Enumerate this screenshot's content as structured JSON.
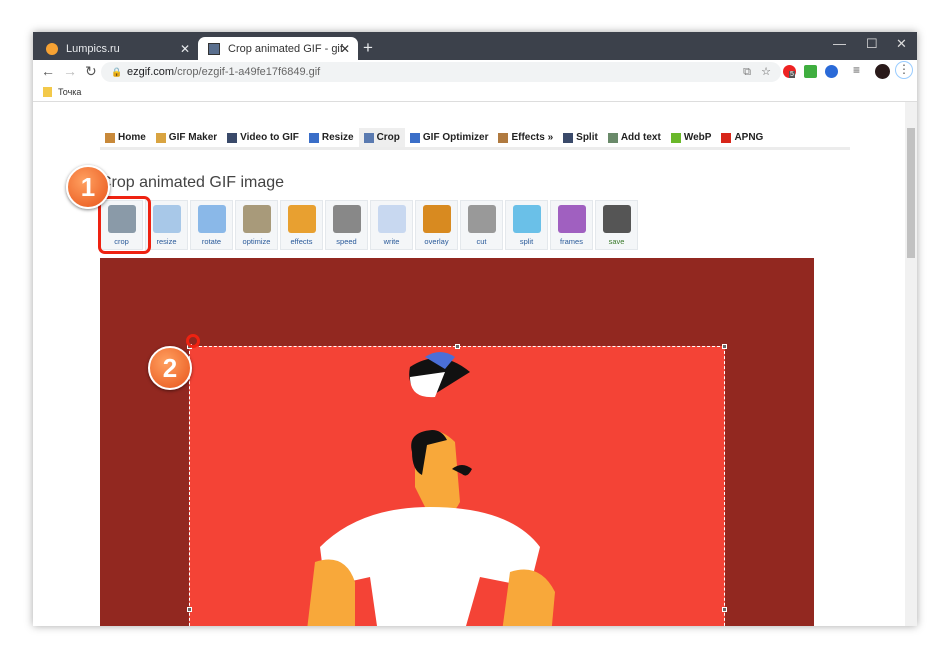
{
  "browser": {
    "tabs": [
      {
        "label": "Lumpics.ru"
      },
      {
        "label": "Crop animated GIF - gif-man-me"
      }
    ],
    "url_host": "ezgif.com",
    "url_path": "/crop/ezgif-1-a49fe17f6849.gif",
    "bookmarks": [
      {
        "label": "Точка"
      }
    ],
    "extension_badge": "5"
  },
  "site": {
    "menu": [
      {
        "label": "Home",
        "color": "#c8893a"
      },
      {
        "label": "GIF Maker",
        "color": "#d9a441"
      },
      {
        "label": "Video to GIF",
        "color": "#3a4a6a"
      },
      {
        "label": "Resize",
        "color": "#3a6ec8"
      },
      {
        "label": "Crop",
        "color": "#5a7ab0",
        "selected": true
      },
      {
        "label": "GIF Optimizer",
        "color": "#3a6ec8"
      },
      {
        "label": "Effects »",
        "color": "#b07a40"
      },
      {
        "label": "Split",
        "color": "#3a4a6a"
      },
      {
        "label": "Add text",
        "color": "#6a8a6a"
      },
      {
        "label": "WebP",
        "color": "#6ab82a"
      },
      {
        "label": "APNG",
        "color": "#d8261a"
      }
    ],
    "title": "Crop animated GIF image",
    "tools": [
      {
        "label": "crop",
        "color": "#8a9aa8"
      },
      {
        "label": "resize",
        "color": "#a8c8e8"
      },
      {
        "label": "rotate",
        "color": "#8ab8e8"
      },
      {
        "label": "optimize",
        "color": "#a89a7a"
      },
      {
        "label": "effects",
        "color": "#e8a030"
      },
      {
        "label": "speed",
        "color": "#888"
      },
      {
        "label": "write",
        "color": "#c8d8f0"
      },
      {
        "label": "overlay",
        "color": "#d88a20"
      },
      {
        "label": "cut",
        "color": "#999"
      },
      {
        "label": "split",
        "color": "#6ac0e8"
      },
      {
        "label": "frames",
        "color": "#a060c0"
      },
      {
        "label": "save",
        "color": "#555"
      }
    ]
  },
  "annotations": [
    "1",
    "2"
  ],
  "colors": {
    "image_bg": "#922820",
    "crop_area": "#f44336",
    "highlight": "#ee2211"
  }
}
